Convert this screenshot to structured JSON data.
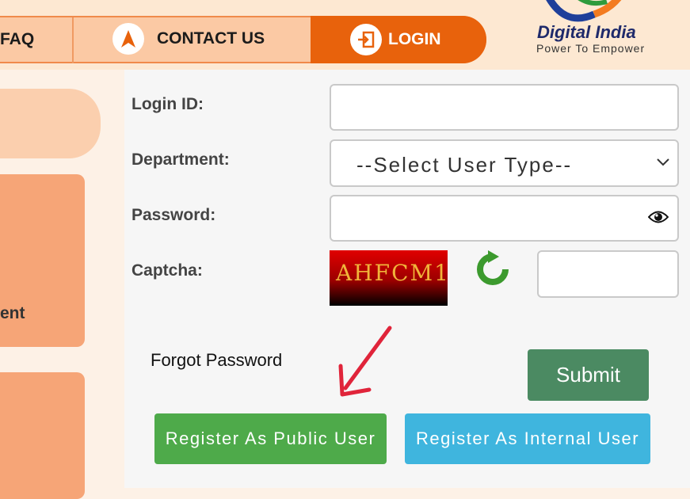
{
  "nav": {
    "faq_label": "FAQ",
    "contact_label": "CONTACT US",
    "login_label": "LOGIN"
  },
  "logo": {
    "title": "Digital India",
    "tagline": "Power To Empower"
  },
  "sidebar": {
    "partial_text": "ent"
  },
  "form": {
    "login_id_label": "Login ID:",
    "department_label": "Department:",
    "department_selected": "--Select User Type--",
    "password_label": "Password:",
    "captcha_label": "Captcha:",
    "captcha_text": "AHFCM1",
    "forgot_password": "Forgot Password",
    "submit_label": "Submit",
    "register_public_label": "Register As Public User",
    "register_internal_label": "Register As Internal User"
  },
  "colors": {
    "nav_bg": "#fbc9a4",
    "login_active": "#e8620c",
    "submit": "#4b8a62",
    "register_public": "#4eaa4a",
    "register_internal": "#3fb5de",
    "annotation_arrow": "#e0243a"
  },
  "icons": {
    "contact": "compass-arrow-icon",
    "login": "login-door-icon",
    "password_toggle": "eye-icon",
    "captcha_refresh": "refresh-icon"
  }
}
